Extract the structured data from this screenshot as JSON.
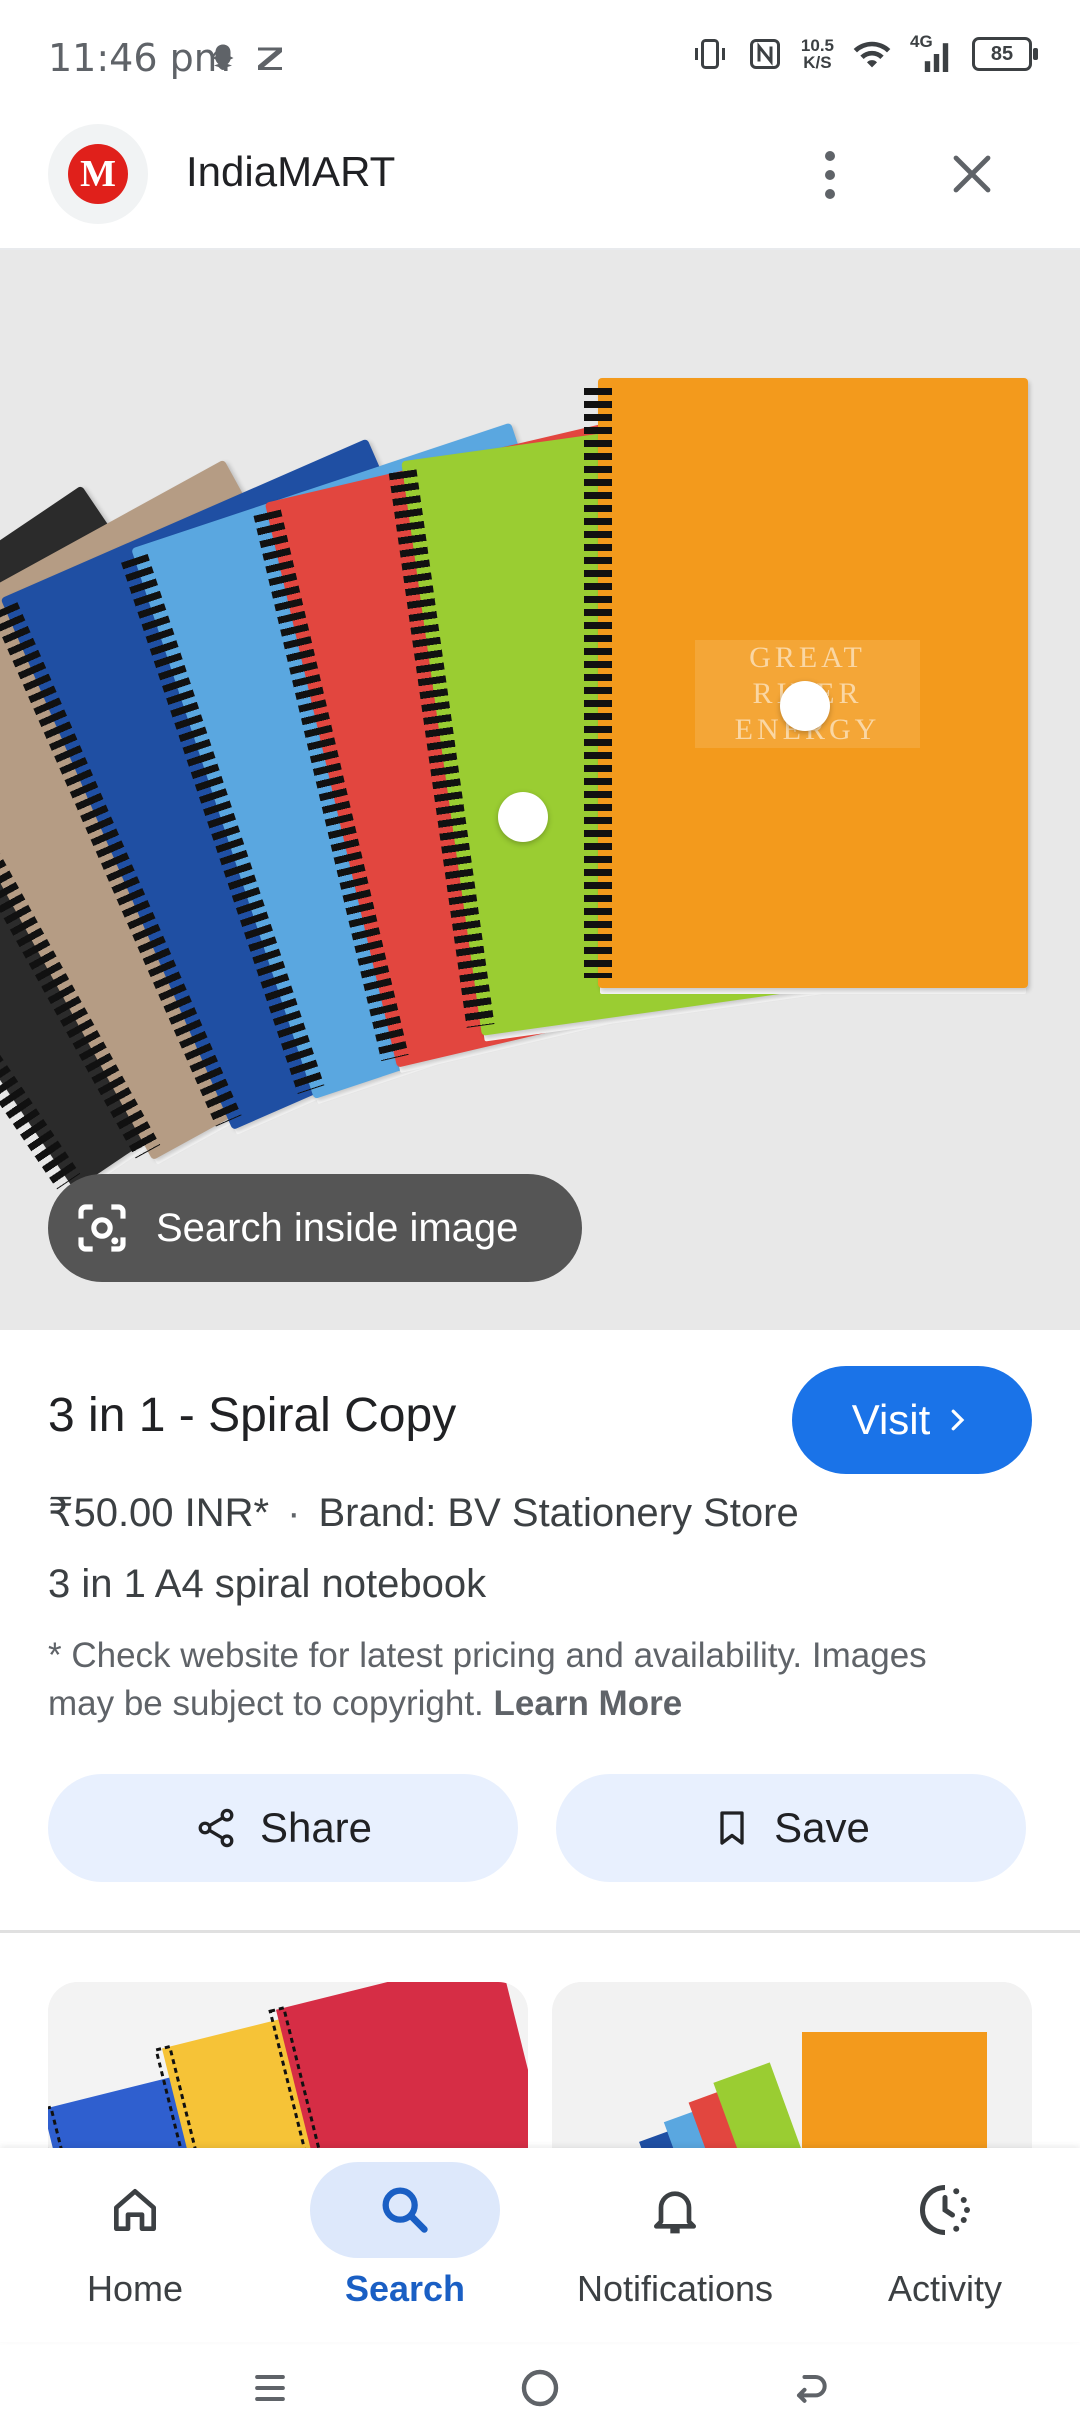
{
  "status_bar": {
    "time": "11:46 pm",
    "speed_top": "10.5",
    "speed_bottom": "K/S",
    "network": "4G",
    "battery": "85"
  },
  "header": {
    "site_name": "IndiaMART",
    "logo_letter": "M"
  },
  "image": {
    "brand_line1": "GREAT RIVER",
    "brand_line2": "ENERGY",
    "search_inside_label": "Search inside image",
    "notebook_colors": [
      "#2b2b2b",
      "#b59c84",
      "#1f4fa3",
      "#5aa7e0",
      "#e2463f",
      "#9acd32",
      "#f39a1c"
    ]
  },
  "product": {
    "title": "3 in 1 - Spiral Copy",
    "visit_label": "Visit",
    "price": "₹50.00 INR*",
    "brand": "Brand: BV Stationery Store",
    "description": "3 in 1 A4 spiral notebook",
    "disclaimer": "* Check website for latest pricing and availability. Images may be subject to copyright.",
    "learn_more": "Learn More",
    "share_label": "Share",
    "save_label": "Save"
  },
  "bottom_nav": {
    "items": [
      {
        "label": "Home",
        "icon": "home-icon"
      },
      {
        "label": "Search",
        "icon": "search-icon",
        "active": true
      },
      {
        "label": "Notifications",
        "icon": "bell-icon"
      },
      {
        "label": "Activity",
        "icon": "activity-icon"
      }
    ]
  },
  "colors": {
    "accent": "#1a73e8",
    "pill_bg": "#e8f0fe",
    "active_nav_bg": "#dde8fb"
  }
}
